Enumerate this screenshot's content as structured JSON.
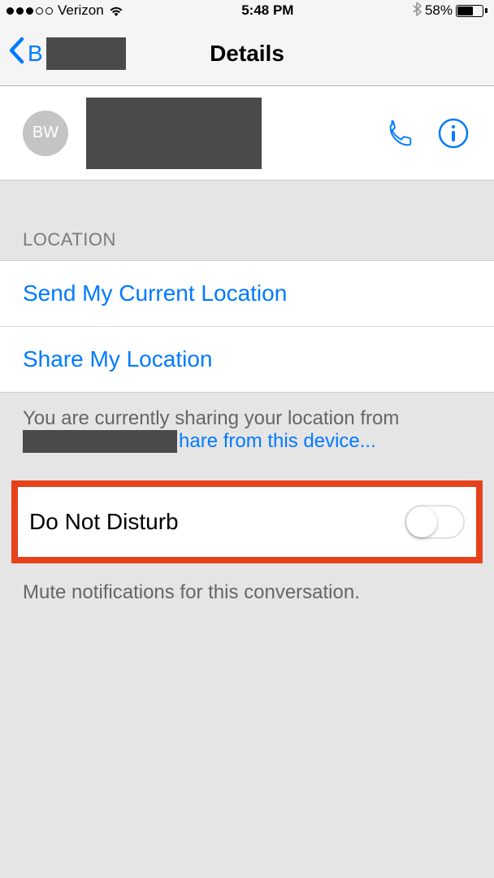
{
  "status": {
    "carrier": "Verizon",
    "time": "5:48 PM",
    "battery_pct": "58%"
  },
  "nav": {
    "back_prefix": "B",
    "title": "Details"
  },
  "contact": {
    "initials": "BW"
  },
  "location": {
    "header": "LOCATION",
    "send_current": "Send My Current Location",
    "share": "Share My Location",
    "footer_line1": "You are currently sharing your location from",
    "footer_link": "hare from this device..."
  },
  "dnd": {
    "label": "Do Not Disturb",
    "footer": "Mute notifications for this conversation."
  }
}
